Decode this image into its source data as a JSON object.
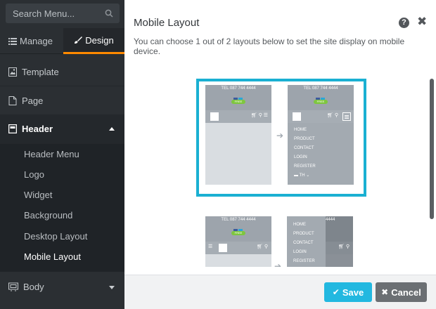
{
  "sidebar": {
    "search_placeholder": "Search Menu...",
    "tabs": [
      {
        "label": "Manage",
        "icon": "list-icon"
      },
      {
        "label": "Design",
        "icon": "brush-icon"
      }
    ],
    "nav": {
      "template": "Template",
      "page": "Page",
      "header": "Header",
      "body": "Body"
    },
    "header_items": [
      "Header Menu",
      "Logo",
      "Widget",
      "Background",
      "Desktop Layout",
      "Mobile Layout"
    ],
    "active_item": "Mobile Layout"
  },
  "panel": {
    "title": "Mobile Layout",
    "description": "You can choose 1 out of 2 layouts below to set the site display on mobile device.",
    "help_icon": "question-circle-icon",
    "close_icon": "close-icon"
  },
  "preview": {
    "tel": "TEL 087 744 4444",
    "badge": "FREE",
    "menu": [
      "HOME",
      "PRODUCT",
      "CONTACT",
      "LOGIN",
      "REGISTER"
    ],
    "lang": "TH",
    "overlay_tel": "4444"
  },
  "footer": {
    "save_label": "Save",
    "cancel_label": "Cancel"
  },
  "colors": {
    "accent": "#1ab0d2",
    "design_tab_underline": "#ff8a00",
    "save": "#22b8e0",
    "cancel": "#6b6f73"
  }
}
